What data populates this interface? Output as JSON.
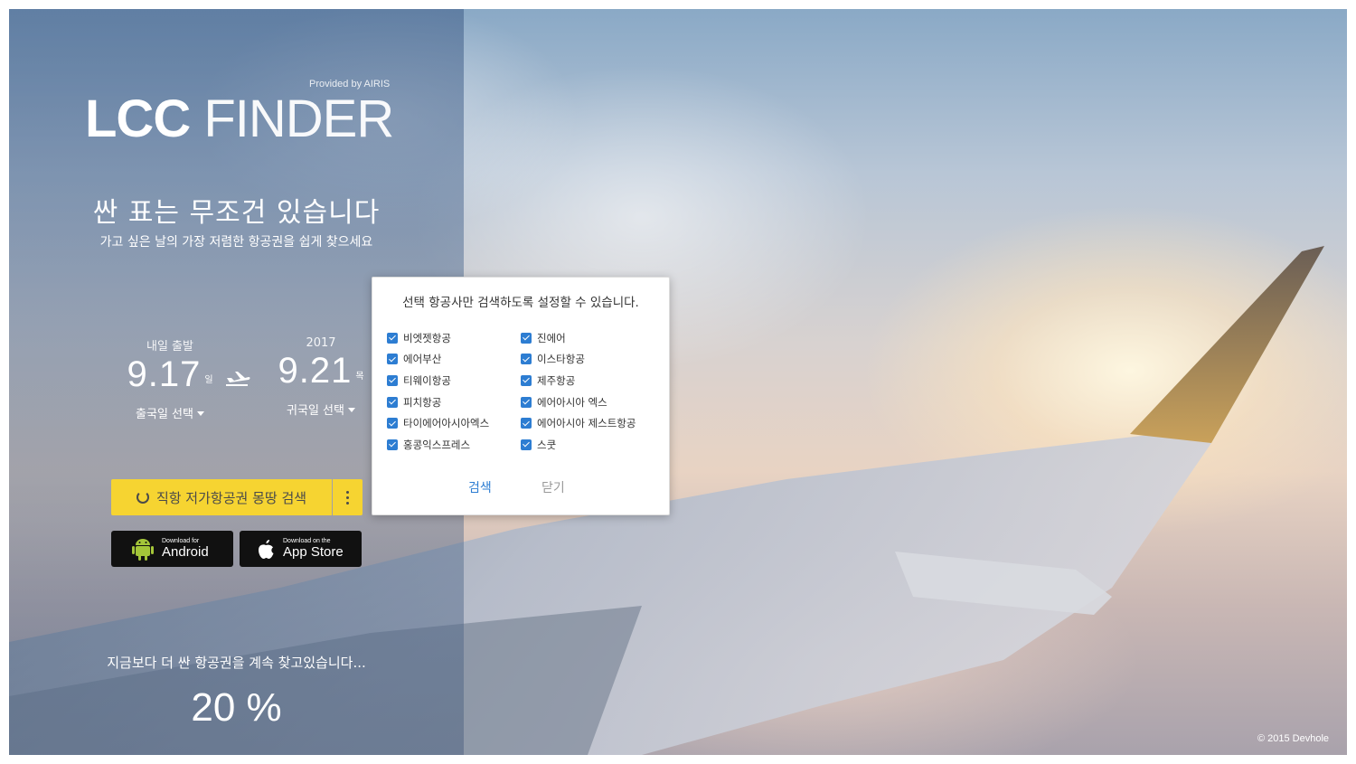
{
  "brand": {
    "provided_by": "Provided by AIRIS",
    "logo_bold": "LCC",
    "logo_thin": "FINDER"
  },
  "hero": {
    "headline": "싼 표는 무조건 있습니다",
    "subhead": "가고 싶은 날의 가장 저렴한 항공권을 쉽게 찾으세요"
  },
  "departure": {
    "label": "내일 출발",
    "date": "9.17",
    "weekday": "일",
    "select_label": "출국일 선택"
  },
  "return": {
    "label": "2017",
    "date": "9.21",
    "weekday": "목",
    "select_label": "귀국일 선택"
  },
  "actions": {
    "search_label": "직항 저가항공권 몽땅 검색"
  },
  "stores": {
    "android_small": "Download for",
    "android_big": "Android",
    "ios_small": "Download on the",
    "ios_big": "App Store"
  },
  "progress": {
    "text": "지금보다 더 싼 항공권을 계속 찾고있습니다...",
    "value": "20 %"
  },
  "footer": {
    "copyright": "© 2015 Devhole"
  },
  "modal": {
    "title": "선택 항공사만 검색하도록 설정할 수 있습니다.",
    "airlines_left": [
      "비엣젯항공",
      "에어부산",
      "티웨이항공",
      "피치항공",
      "타이에어아시아엑스",
      "홍콩익스프레스"
    ],
    "airlines_right": [
      "진에어",
      "이스타항공",
      "제주항공",
      "에어아시아 엑스",
      "에어아시아 제스트항공",
      "스쿳"
    ],
    "search_button": "검색",
    "close_button": "닫기"
  },
  "colors": {
    "accent_yellow": "#f6d431",
    "checkbox_blue": "#2d7dd2"
  }
}
